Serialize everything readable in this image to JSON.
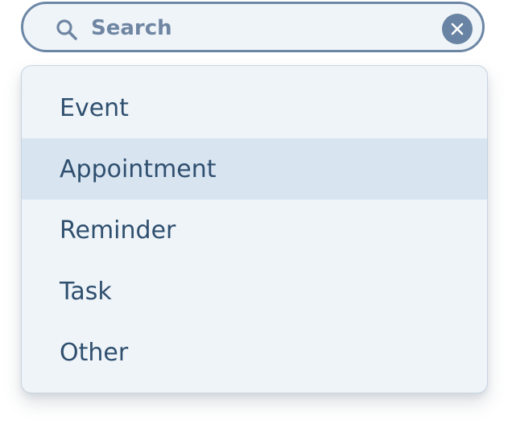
{
  "search": {
    "placeholder": "Search",
    "value": "",
    "search_icon": "search-icon",
    "clear_icon": "close-icon"
  },
  "dropdown": {
    "items": [
      {
        "label": "Event",
        "highlighted": false
      },
      {
        "label": "Appointment",
        "highlighted": true
      },
      {
        "label": "Reminder",
        "highlighted": false
      },
      {
        "label": "Task",
        "highlighted": false
      },
      {
        "label": "Other",
        "highlighted": false
      }
    ]
  },
  "colors": {
    "border": "#6c87a6",
    "field_background": "#eff4f8",
    "highlight": "#d8e4f0",
    "item_text": "#2f4f6f",
    "placeholder_text": "#6f86a3"
  }
}
